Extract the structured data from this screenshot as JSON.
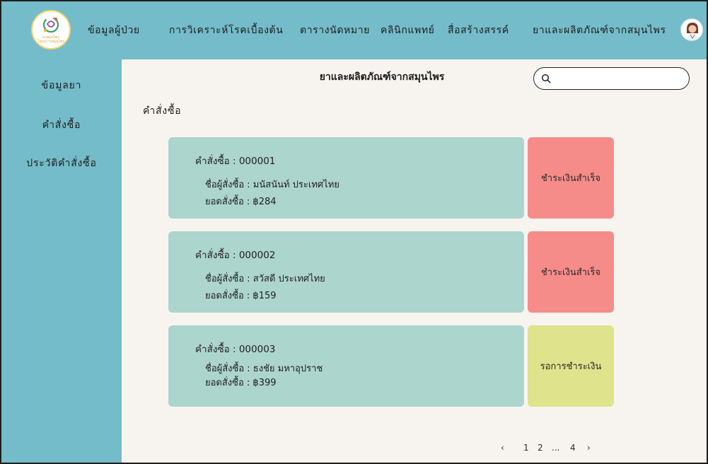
{
  "logo": {
    "line1": "ยาสมุนไพร",
    "line2": "โครงการสมุนไพร"
  },
  "nav": {
    "items": [
      "ข้อมูลผู้ป่วย",
      "การวิเคราะห์โรคเบื้องต้น",
      "ตารางนัดหมาย",
      "คลินิกแพทย์",
      "สื่อสร้างสรรค์",
      "ยาและผลิตภัณฑ์จากสมุนไพร"
    ]
  },
  "sidebar": {
    "items": [
      "ข้อมูลยา",
      "คำสั่งซื้อ",
      "ประวัติคำสั่งซื้อ"
    ]
  },
  "main": {
    "title": "ยาและผลิตภัณฑ์จากสมุนไพร",
    "search_placeholder": "",
    "section_label": "คำสั่งซื้อ"
  },
  "orders": [
    {
      "id_text": "คำสั่งซื้อ : 000001",
      "buyer_text": "ชื่อผู้สั่งซื้อ : มนัสนันท์ ประเทศไทย",
      "total_text": "ยอดสั่งซื้อ : ฿284",
      "status": "ชำระเงินสำเร็จ",
      "status_type": "paid"
    },
    {
      "id_text": "คำสั่งซื้อ : 000002",
      "buyer_text": "ชื่อผู้สั่งซื้อ : สวัสดี ประเทศไทย",
      "total_text": "ยอดสั่งซื้อ : ฿159",
      "status": "ชำระเงินสำเร็จ",
      "status_type": "paid"
    },
    {
      "id_text": "คำสั่งซื้อ : 000003",
      "buyer_text": "ชื่อผู้สั่งซื้อ : ธงชัย มหาอุปราช",
      "total_text": "ยอดสั่งซื้อ : ฿399",
      "status": "รอการชำระเงิน",
      "status_type": "pending"
    }
  ],
  "pagination": {
    "prev": "‹",
    "pages": [
      "1",
      "2",
      "...",
      "4"
    ],
    "next": "›"
  },
  "colors": {
    "nav_bg": "#74bcc9",
    "content_bg": "#f7f4f0",
    "card_bg": "#acd5cd",
    "status_paid": "#f68c89",
    "status_pending": "#dfe38b"
  },
  "icons": {
    "search": "search-icon",
    "avatar": "doctor-avatar-icon",
    "logo": "herb-logo-icon"
  }
}
